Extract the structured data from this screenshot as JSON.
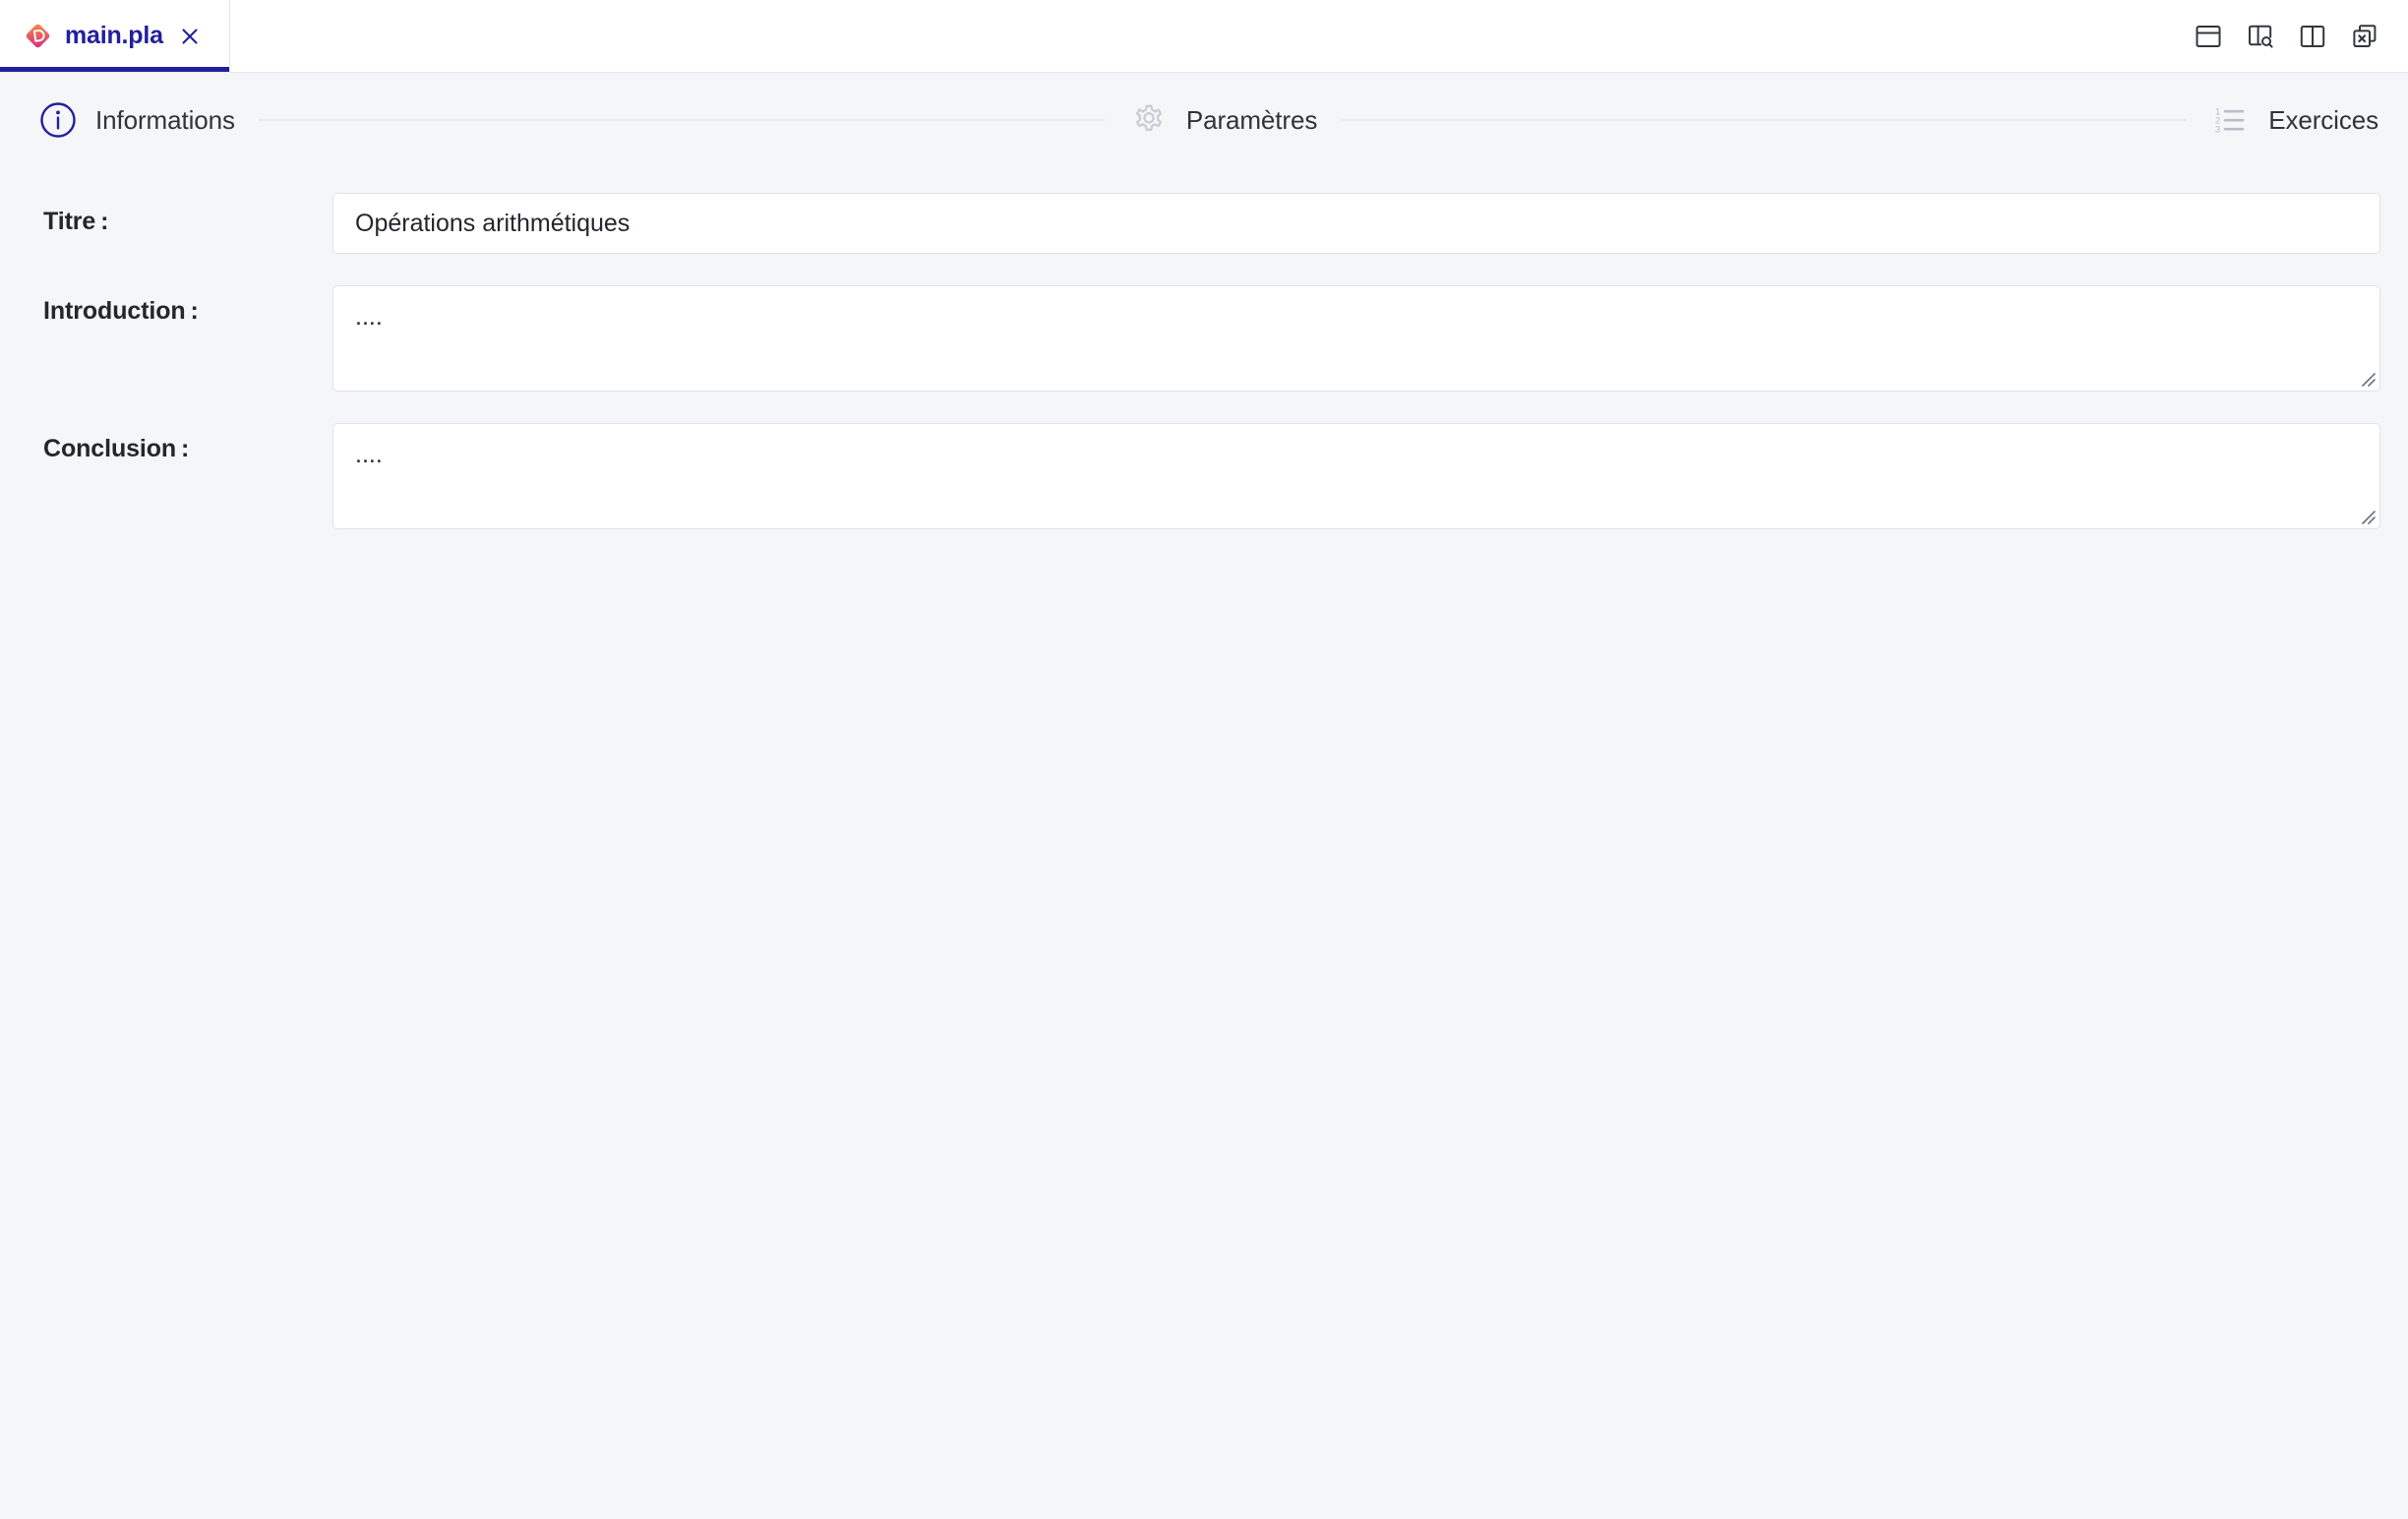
{
  "window": {
    "tabs": [
      {
        "label": "main.pla",
        "icon": "plan-file-icon",
        "active": true,
        "close_icon": "close-icon"
      }
    ],
    "toolbar_icons": [
      {
        "name": "panel-top-layout-icon",
        "title": "Panel top"
      },
      {
        "name": "panel-left-search-icon",
        "title": "Panel left search"
      },
      {
        "name": "split-vertical-icon",
        "title": "Split vertical"
      },
      {
        "name": "close-all-tabs-icon",
        "title": "Close all"
      }
    ]
  },
  "stepper": {
    "steps": [
      {
        "label": "Informations",
        "icon": "info-circle-icon",
        "active": true
      },
      {
        "label": "Paramètres",
        "icon": "gear-icon",
        "active": false
      },
      {
        "label": "Exercices",
        "icon": "ordered-list-icon",
        "active": false
      }
    ]
  },
  "form": {
    "fields": [
      {
        "label": "Titre :",
        "type": "input",
        "value": "Opérations arithmétiques",
        "placeholder": ""
      },
      {
        "label": "Introduction :",
        "type": "textarea",
        "value": "....",
        "placeholder": ""
      },
      {
        "label": "Conclusion :",
        "type": "textarea",
        "value": "....",
        "placeholder": ""
      }
    ]
  },
  "colors": {
    "accent": "#21209c",
    "background": "#f5f6f8",
    "surface": "#ffffff",
    "border": "#dfe2e6",
    "text": "#23272b",
    "muted": "#c6cacf",
    "icon_gradient_start": "#f08a3c",
    "icon_gradient_end": "#d4357f"
  }
}
